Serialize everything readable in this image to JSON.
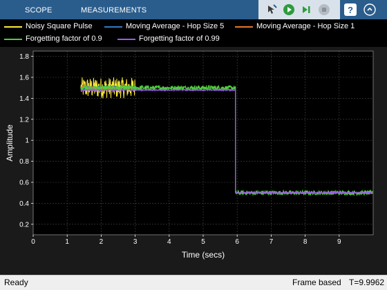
{
  "toolbar": {
    "tabs": [
      "SCOPE",
      "MEASUREMENTS"
    ],
    "controls": [
      "zoom-tool-icon",
      "run-icon",
      "step-forward-icon",
      "stop-icon"
    ],
    "help_icon": "help-icon",
    "undock_icon": "undock-icon",
    "background_color": "#2b5d8c"
  },
  "legend": {
    "entries": [
      {
        "label": "Noisy Square Pulse",
        "color": "#ffeb3b"
      },
      {
        "label": "Moving Average - Hop Size 5",
        "color": "#2f7dc4"
      },
      {
        "label": "Moving Average - Hop Size 1",
        "color": "#e8762b"
      },
      {
        "label": "Forgetting factor of 0.9",
        "color": "#4cd137"
      },
      {
        "label": "Forgetting factor of 0.99",
        "color": "#9b5de5"
      }
    ]
  },
  "chart_data": {
    "type": "line",
    "xlabel": "Time (secs)",
    "ylabel": "Amplitude",
    "xlim": [
      0,
      10
    ],
    "ylim": [
      0.1,
      1.85
    ],
    "x_ticks": [
      0,
      1,
      2,
      3,
      4,
      5,
      6,
      7,
      8,
      9
    ],
    "x_tick_labels": [
      "0",
      "1",
      "2",
      "3",
      "4",
      "5",
      "6",
      "7",
      "8",
      "9"
    ],
    "y_ticks": [
      0.2,
      0.4,
      0.6,
      0.8,
      1.0,
      1.2,
      1.4,
      1.6,
      1.8
    ],
    "y_tick_labels": [
      "0.2",
      "0.4",
      "0.6",
      "0.8",
      "1",
      "1.2",
      "1.4",
      "1.6",
      "1.8"
    ],
    "grid": true,
    "legend_position": "top",
    "series": [
      {
        "name": "Noisy Square Pulse",
        "color": "#ffeb3b",
        "x": [
          1.4,
          3.0
        ],
        "y": [
          1.5,
          1.5
        ],
        "noise_amplitude": 0.1
      },
      {
        "name": "Moving Average - Hop Size 5",
        "color": "#2f7dc4",
        "x": [
          1.4,
          3.0
        ],
        "y": [
          1.5,
          1.5
        ],
        "noise_amplitude": 0.02
      },
      {
        "name": "Moving Average - Hop Size 1",
        "color": "#e8762b",
        "x": [
          1.4,
          3.0
        ],
        "y": [
          1.5,
          1.5
        ],
        "noise_amplitude": 0.015
      },
      {
        "name": "Forgetting factor of 0.9",
        "color": "#4cd137",
        "x": [
          1.4,
          5.95,
          5.95,
          9.98
        ],
        "y": [
          1.5,
          1.5,
          0.5,
          0.5
        ],
        "noise_amplitude": 0.02
      },
      {
        "name": "Forgetting factor of 0.99",
        "color": "#9b5de5",
        "x": [
          1.4,
          5.95,
          5.95,
          9.98
        ],
        "y": [
          1.48,
          1.48,
          0.5,
          0.5
        ],
        "noise_amplitude": 0.006
      }
    ],
    "plot_background": "#000000",
    "grid_color": "#4a4a4a",
    "axis_color": "#ffffff"
  },
  "status": {
    "left": "Ready",
    "mode": "Frame based",
    "time": "T=9.9962"
  }
}
